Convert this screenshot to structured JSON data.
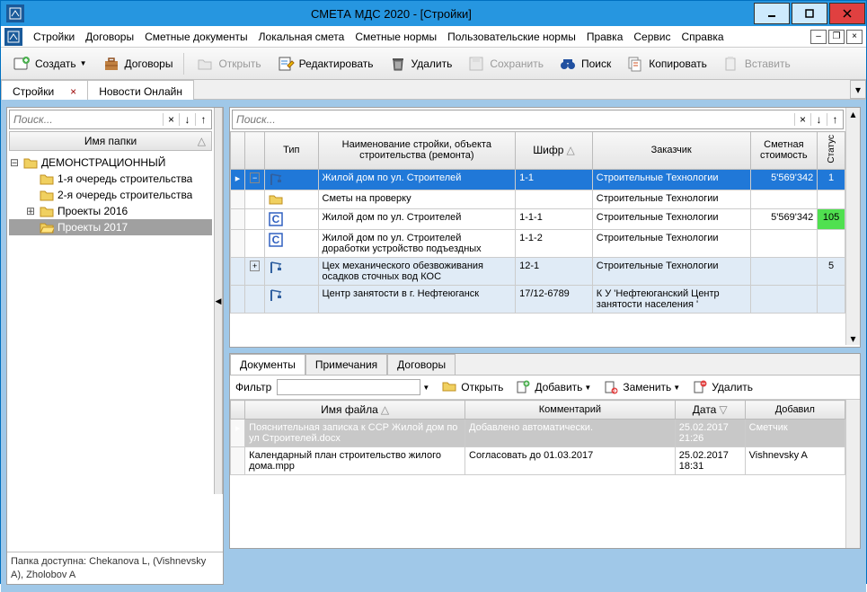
{
  "window": {
    "title": "СМЕТА МДС 2020    -  [Стройки]"
  },
  "menu": [
    "Стройки",
    "Договоры",
    "Сметные документы",
    "Локальная смета",
    "Сметные нормы",
    "Пользовательские нормы",
    "Правка",
    "Сервис",
    "Справка"
  ],
  "toolbar": {
    "create": "Создать",
    "contracts": "Договоры",
    "open": "Открыть",
    "edit": "Редактировать",
    "delete": "Удалить",
    "save": "Сохранить",
    "search": "Поиск",
    "copy": "Копировать",
    "paste": "Вставить"
  },
  "tabs": {
    "main": "Стройки",
    "news": "Новости Онлайн"
  },
  "search_placeholder": "Поиск...",
  "tree": {
    "header": "Имя папки",
    "root": "ДЕМОНСТРАЦИОННЫЙ",
    "items": [
      "1-я очередь строительства",
      "2-я очередь строительства",
      "Проекты 2016",
      "Проекты 2017"
    ]
  },
  "status_line": "Папка доступна: Chekanova L, (Vishnevsky A), Zholobov A",
  "grid": {
    "columns": [
      "Тип",
      "Наименование стройки, объекта строительства (ремонта)",
      "Шифр",
      "Заказчик",
      "Сметная стоимость",
      "Статус"
    ],
    "rows": [
      {
        "name": "Жилой дом по ул. Строителей",
        "code": "1-1",
        "cust": "Строительные Технологии",
        "cost": "5'569'342",
        "status": "1",
        "sel": true,
        "icon": "crane",
        "toggle": "-"
      },
      {
        "name": "Сметы на проверку",
        "code": "",
        "cust": "Строительные Технологии",
        "cost": "",
        "status": "",
        "icon": "folder"
      },
      {
        "name": "Жилой дом по ул. Строителей",
        "code": "1-1-1",
        "cust": "Строительные Технологии",
        "cost": "5'569'342",
        "status": "105",
        "statusColor": "green",
        "icon": "C"
      },
      {
        "name": "Жилой дом по ул. Строителей доработки устройство подъездных",
        "code": "1-1-2",
        "cust": "Строительные Технологии",
        "cost": "",
        "status": "",
        "icon": "C"
      },
      {
        "name": "Цех механического обезвоживания осадков сточных вод КОС",
        "code": "12-1",
        "cust": "Строительные Технологии",
        "cost": "",
        "status": "5",
        "statusColor": "dgreen",
        "alt": true,
        "icon": "crane",
        "toggle": "+"
      },
      {
        "name": "Центр занятости в г. Нефтеюганск",
        "code": "17/12-6789",
        "cust": "К У 'Нефтеюганский Центр занятости населения '",
        "cost": "",
        "status": "",
        "alt": true,
        "icon": "crane"
      }
    ]
  },
  "bottom": {
    "tabs": [
      "Документы",
      "Примечания",
      "Договоры"
    ],
    "filter_label": "Фильтр",
    "btn_open": "Открыть",
    "btn_add": "Добавить",
    "btn_replace": "Заменить",
    "btn_delete": "Удалить",
    "columns": [
      "Имя файла",
      "Комментарий",
      "Дата",
      "Добавил"
    ],
    "rows": [
      {
        "file": "Пояснительная записка к ССР Жилой дом по ул Строителей.docx",
        "comment": "Добавлено автоматически.",
        "date": "25.02.2017 21:26",
        "author": "Сметчик",
        "sel": true
      },
      {
        "file": "Календарный план строительство жилого дома.mpp",
        "comment": "Согласовать до 01.03.2017",
        "date": "25.02.2017 18:31",
        "author": "Vishnevsky A"
      }
    ]
  }
}
